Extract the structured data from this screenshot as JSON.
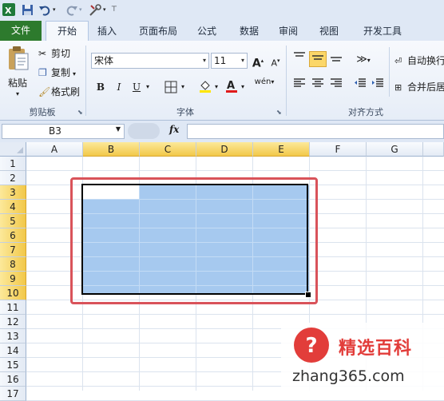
{
  "tabs": [
    "文件",
    "开始",
    "插入",
    "页面布局",
    "公式",
    "数据",
    "审阅",
    "视图",
    "开发工具"
  ],
  "clipboard": {
    "paste": "粘贴",
    "cut": "剪切",
    "copy": "复制",
    "format_painter": "格式刷",
    "group": "剪贴板"
  },
  "font": {
    "name": "宋体",
    "size": "11",
    "group": "字体",
    "bold": "B",
    "italic": "I",
    "underline": "U",
    "grow": "A",
    "shrink": "A",
    "phonetic": "wén"
  },
  "alignment": {
    "wrap": "自动换行",
    "merge": "合并后居",
    "group": "对齐方式"
  },
  "formula_bar": {
    "name_box": "B3",
    "fx": "fx",
    "formula": ""
  },
  "columns": [
    "A",
    "B",
    "C",
    "D",
    "E",
    "F",
    "G"
  ],
  "rows": [
    "1",
    "2",
    "3",
    "4",
    "5",
    "6",
    "7",
    "8",
    "9",
    "10",
    "11",
    "12",
    "13",
    "14",
    "15",
    "16",
    "17"
  ],
  "watermark": {
    "cn": "精选百科",
    "url": "zhang365.com",
    "badge": "?"
  },
  "colors": {
    "file_tab": "#2d7a2d",
    "selection": "#a6c9ef",
    "header_selected": "#f2c84a",
    "highlight_box": "#d9535a",
    "watermark_red": "#e23d3a"
  }
}
